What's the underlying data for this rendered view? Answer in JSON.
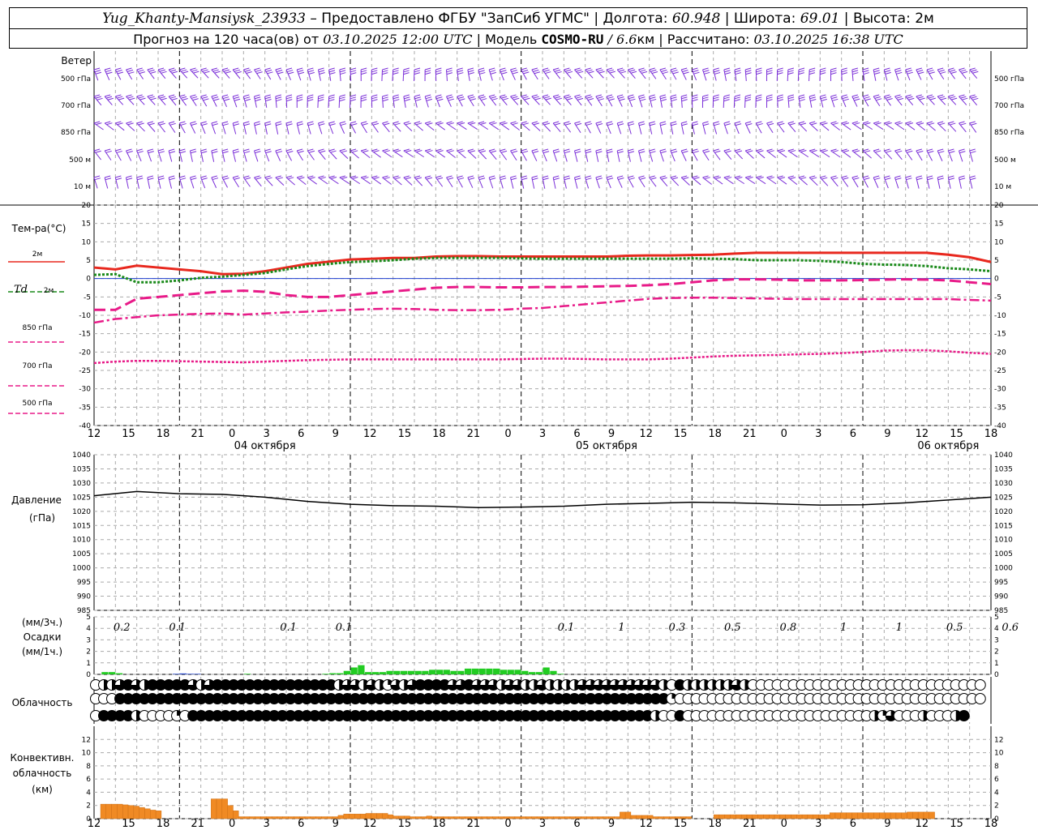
{
  "header": {
    "station": "Yug_Khanty-Mansiysk_23933",
    "provider": " – Предоставлено ФГБУ \"ЗапСиб УГМС\" | Долгота: ",
    "longitude": "60.948",
    "lat_label": " | Широта: ",
    "latitude": "69.01",
    "alt_label": " | Высота: 2м",
    "forecast_prefix": "Прогноз на 120 часа(ов) от ",
    "run_time": "03.10.2025 12:00 UTC",
    "model_prefix": " | Модель ",
    "model": "COSMO-RU",
    "resolution": " / 6.6",
    "res_unit": "км | Рассчитано: ",
    "computed": "03.10.2025 16:38 UTC"
  },
  "colors": {
    "wind": "#7b2fd8",
    "t2m": "#e8281e",
    "td2m": "#1a8a1a",
    "t850": "#e81a88",
    "t700": "#e81a88",
    "t500": "#e81a88",
    "zero": "#1f3fd0",
    "pressure": "#000000",
    "precip": "#22cc22",
    "precip_small": "#2244cc",
    "convective": "#f08a24",
    "grid": "#aaaaaa"
  },
  "x_axis": {
    "hours": [
      "12",
      "15",
      "18",
      "21",
      "0",
      "3",
      "6",
      "9",
      "12",
      "15",
      "18",
      "21",
      "0",
      "3",
      "6",
      "9",
      "12",
      "15",
      "18",
      "21",
      "0",
      "3",
      "6",
      "9",
      "12",
      "15",
      "18"
    ],
    "day_labels": [
      "04 октября",
      "05 октября",
      "06 октября"
    ]
  },
  "wind_panel": {
    "title": "Ветер",
    "levels": [
      "500 гПа",
      "700 гПа",
      "850 гПа",
      "500 м",
      "10  м"
    ]
  },
  "chart_data": [
    {
      "type": "line",
      "title": "Тем-ра(°C)",
      "ylim": [
        -40,
        20
      ],
      "yticks": [
        "20",
        "15",
        "10",
        "5",
        "0",
        "-5",
        "-10",
        "-15",
        "-20",
        "-25",
        "-30",
        "-35",
        "-40"
      ],
      "x_hours_from_start": [
        0,
        3,
        6,
        9,
        12,
        15,
        18,
        21,
        24,
        27,
        30,
        33,
        36,
        39,
        42,
        45,
        48,
        51,
        54,
        57,
        60,
        63,
        66,
        69,
        72,
        75,
        78,
        81,
        84,
        87,
        90,
        93,
        96,
        99,
        102,
        105,
        108,
        111,
        114,
        117,
        120,
        123,
        126
      ],
      "series": [
        {
          "name": "2м",
          "values": [
            3,
            2.5,
            3.5,
            3,
            2.5,
            2,
            1.2,
            1.3,
            2,
            3,
            4,
            4.6,
            5.2,
            5.4,
            5.6,
            5.6,
            6,
            6.1,
            6.1,
            6,
            6,
            6,
            6,
            6,
            6,
            6.2,
            6.3,
            6.3,
            6.4,
            6.5,
            6.8,
            7,
            7,
            7,
            7,
            7,
            7,
            7,
            7,
            7,
            6.5,
            5.8,
            4.5
          ]
        },
        {
          "name": "Td 2м",
          "values": [
            1,
            1.2,
            -1,
            -1,
            -0.5,
            0.2,
            0.5,
            1,
            1.5,
            2.5,
            3.4,
            4,
            4.5,
            4.7,
            5,
            5.4,
            5.6,
            5.6,
            5.6,
            5.6,
            5.5,
            5.4,
            5.4,
            5.4,
            5.4,
            5.4,
            5.4,
            5.4,
            5.5,
            5.4,
            5.3,
            5,
            5,
            5,
            4.8,
            4.5,
            4,
            3.8,
            3.7,
            3.4,
            2.8,
            2.5,
            2
          ]
        },
        {
          "name": "850 гПа",
          "values": [
            -8.5,
            -8.5,
            -5.5,
            -5,
            -4.5,
            -4,
            -3.5,
            -3.3,
            -3.6,
            -4.5,
            -5,
            -5,
            -4.5,
            -4,
            -3.5,
            -3,
            -2.5,
            -2.3,
            -2.3,
            -2.4,
            -2.4,
            -2.3,
            -2.3,
            -2.2,
            -2.1,
            -2,
            -1.8,
            -1.5,
            -1,
            -0.5,
            -0.2,
            -0.2,
            -0.3,
            -0.5,
            -0.5,
            -0.5,
            -0.4,
            -0.3,
            -0.2,
            -0.3,
            -0.5,
            -1,
            -1.5
          ]
        },
        {
          "name": "700 гПа",
          "values": [
            -12,
            -11,
            -10.5,
            -10,
            -9.8,
            -9.6,
            -9.5,
            -9.8,
            -9.5,
            -9.2,
            -9,
            -8.7,
            -8.5,
            -8.3,
            -8.2,
            -8.3,
            -8.5,
            -8.6,
            -8.6,
            -8.5,
            -8.2,
            -8,
            -7.5,
            -7,
            -6.5,
            -6,
            -5.5,
            -5.3,
            -5.2,
            -5.2,
            -5.3,
            -5.4,
            -5.5,
            -5.6,
            -5.6,
            -5.6,
            -5.6,
            -5.6,
            -5.6,
            -5.6,
            -5.6,
            -5.8,
            -6
          ]
        },
        {
          "name": "500 гПа",
          "values": [
            -23,
            -22.6,
            -22.4,
            -22.4,
            -22.5,
            -22.6,
            -22.7,
            -22.8,
            -22.6,
            -22.4,
            -22.2,
            -22.1,
            -22,
            -22,
            -22,
            -22,
            -22,
            -22,
            -22,
            -22,
            -21.9,
            -21.8,
            -21.8,
            -21.9,
            -22,
            -22,
            -22,
            -21.8,
            -21.5,
            -21.2,
            -21,
            -20.9,
            -20.8,
            -20.6,
            -20.5,
            -20.3,
            -20,
            -19.6,
            -19.5,
            -19.5,
            -19.8,
            -20.2,
            -20.5
          ]
        }
      ]
    },
    {
      "type": "line",
      "title": "Давление",
      "ylabel": "(гПа)",
      "ylim": [
        985,
        1040
      ],
      "yticks": [
        "1040",
        "1035",
        "1030",
        "1025",
        "1020",
        "1015",
        "1010",
        "1005",
        "1000",
        "995",
        "990",
        "985"
      ],
      "x_hours_from_start": [
        0,
        6,
        12,
        18,
        24,
        30,
        36,
        42,
        48,
        54,
        60,
        66,
        72,
        78,
        84,
        90,
        96,
        102,
        108,
        114,
        120,
        126
      ],
      "values": [
        1025.5,
        1027,
        1026.2,
        1026,
        1025,
        1023.5,
        1022.5,
        1022,
        1021.8,
        1021.3,
        1021.5,
        1021.8,
        1022.5,
        1022.8,
        1023.2,
        1023,
        1022.6,
        1022.2,
        1022.3,
        1023,
        1024,
        1025
      ]
    },
    {
      "type": "bar",
      "title": "Осадки",
      "ylabel_top": "(мм/3ч.)",
      "ylabel_bottom": "(мм/1ч.)",
      "ylim": [
        0,
        5
      ],
      "yticks": [
        "5",
        "4",
        "3",
        "2",
        "1",
        "0"
      ],
      "labels_3h": [
        {
          "hour": "1.5",
          "text": "0.2"
        },
        {
          "hour": "4.5",
          "text": "0.1"
        },
        {
          "hour": "10.5",
          "text": "0.1"
        },
        {
          "hour": "13.5",
          "text": "0.1"
        },
        {
          "hour": "25.5",
          "text": "0.1"
        },
        {
          "hour": "28.5",
          "text": "1"
        },
        {
          "hour": "31.5",
          "text": "0.3"
        },
        {
          "hour": "34.5",
          "text": "0.5"
        },
        {
          "hour": "37.5",
          "text": "0.8"
        },
        {
          "hour": "40.5",
          "text": "1"
        },
        {
          "hour": "43.5",
          "text": "1"
        },
        {
          "hour": "46.5",
          "text": "0.5"
        },
        {
          "hour": "49.5",
          "text": "0.6"
        }
      ],
      "hourly": [
        0,
        0.2,
        0.2,
        0.1,
        0,
        0,
        0,
        0,
        0,
        0,
        0,
        0.05,
        0.08,
        0.05,
        0.05,
        0,
        0,
        0,
        0,
        0,
        0,
        0.05,
        0,
        0,
        0,
        0,
        0,
        0,
        0,
        0,
        0,
        0,
        0.05,
        0.1,
        0.1,
        0.3,
        0.6,
        0.8,
        0.2,
        0.2,
        0.2,
        0.3,
        0.3,
        0.3,
        0.3,
        0.3,
        0.3,
        0.4,
        0.4,
        0.4,
        0.3,
        0.3,
        0.5,
        0.5,
        0.5,
        0.5,
        0.5,
        0.4,
        0.4,
        0.4,
        0.3,
        0.2,
        0.2,
        0.6,
        0.3,
        0.05
      ]
    },
    {
      "type": "bar",
      "title": "Конвективн.",
      "subtitle": "облачность",
      "ylabel": "(км)",
      "ylim": [
        0,
        14
      ],
      "yticks": [
        "12",
        "10",
        "8",
        "6",
        "4",
        "2",
        "0"
      ],
      "hourly": [
        2.2,
        2.2,
        2.2,
        2.2,
        2.1,
        2,
        1.9,
        1.7,
        1.5,
        1.3,
        1.2,
        0,
        0,
        0,
        0,
        0,
        0,
        0,
        0,
        0,
        3,
        3,
        3,
        2,
        1.2,
        0.3,
        0.3,
        0.3,
        0.3,
        0.3,
        0.3,
        0.3,
        0.3,
        0.3,
        0.3,
        0.3,
        0.3,
        0.3,
        0.3,
        0.3,
        0.3,
        0.3,
        0.3,
        0.5,
        0.7,
        0.7,
        0.7,
        0.7,
        0.8,
        0.8,
        0.8,
        0.8,
        0.6,
        0.4,
        0.4,
        0.4,
        0.3,
        0.3,
        0.3,
        0.4,
        0.3,
        0.3,
        0.3,
        0.3,
        0.3,
        0.3,
        0.3,
        0.3,
        0.3,
        0.3,
        0.3,
        0.3,
        0.3,
        0.3,
        0.3,
        0.3,
        0.3,
        0.3,
        0.3,
        0.3,
        0.3,
        0.3,
        0.3,
        0.3,
        0.3,
        0.3,
        0.3,
        0.3,
        0.3,
        0.3,
        0.3,
        0.3,
        0.3,
        0.3,
        1,
        1,
        0.5,
        0.5,
        0.5,
        0.5,
        0.3,
        0.3,
        0.3,
        0.3,
        0.3,
        0.3,
        0.3,
        0,
        0,
        0,
        0,
        0.6,
        0.6,
        0.6,
        0.6,
        0.6,
        0.6,
        0.6,
        0.6,
        0.6,
        0.6,
        0.6,
        0.6,
        0.6,
        0.6,
        0.6,
        0.6,
        0.6,
        0.6,
        0.6,
        0.6,
        0.6,
        0.9,
        0.9,
        0.9,
        0.9,
        0.9,
        0.9,
        0.9,
        0.9,
        0.9,
        0.9,
        0.9,
        0.9,
        0.9,
        0.9,
        1,
        1,
        1,
        1,
        1
      ]
    }
  ],
  "cloud_panel": {
    "title": "Облачность",
    "rows_eighths": [
      [
        0,
        4,
        4,
        6,
        8,
        6,
        4,
        8,
        8,
        8,
        8,
        8,
        6,
        4,
        6,
        8,
        8,
        8,
        8,
        8,
        8,
        8,
        8,
        8,
        8,
        8,
        8,
        8,
        8,
        8,
        4,
        6,
        6,
        4,
        6,
        4,
        2,
        6,
        4,
        6,
        8,
        8,
        8,
        8,
        6,
        6,
        8,
        6,
        6,
        6,
        4,
        6,
        6,
        4,
        4,
        6,
        4,
        4,
        4,
        4,
        6,
        6,
        6,
        6,
        6,
        6,
        6,
        6,
        6,
        6,
        4,
        0,
        8,
        4,
        4,
        4,
        4,
        4,
        4,
        6,
        4,
        0,
        0,
        0,
        0,
        0,
        0,
        0,
        0,
        0,
        0,
        0,
        0,
        0,
        0,
        0,
        0,
        0,
        0,
        0,
        0,
        0,
        0,
        0,
        0,
        0,
        0,
        0,
        0,
        0,
        0,
        0,
        0,
        0
      ],
      [
        0,
        0,
        0,
        8,
        8,
        8,
        8,
        8,
        8,
        8,
        8,
        8,
        8,
        8,
        8,
        8,
        8,
        8,
        8,
        8,
        8,
        8,
        8,
        8,
        8,
        8,
        8,
        8,
        8,
        8,
        8,
        8,
        8,
        8,
        8,
        8,
        8,
        8,
        8,
        8,
        8,
        8,
        8,
        8,
        8,
        8,
        8,
        8,
        8,
        8,
        8,
        8,
        8,
        8,
        8,
        8,
        8,
        8,
        8,
        8,
        8,
        8,
        8,
        8,
        8,
        8,
        8,
        8,
        8,
        8,
        8,
        2,
        0,
        0,
        0,
        0,
        0,
        0,
        0,
        0,
        0,
        0,
        0,
        0,
        0,
        0,
        0,
        0,
        0,
        0,
        0,
        0,
        0,
        0,
        0,
        0,
        0,
        0,
        0,
        0,
        0,
        0,
        0,
        0,
        0,
        0,
        0,
        0,
        0,
        0,
        0,
        0,
        0
      ],
      [
        0,
        8,
        8,
        8,
        8,
        4,
        0,
        0,
        0,
        0,
        2,
        0,
        8,
        8,
        8,
        8,
        8,
        8,
        8,
        8,
        8,
        8,
        8,
        8,
        8,
        8,
        8,
        8,
        8,
        8,
        8,
        8,
        8,
        8,
        8,
        8,
        8,
        8,
        8,
        8,
        8,
        8,
        8,
        8,
        8,
        8,
        8,
        8,
        8,
        8,
        8,
        8,
        8,
        8,
        8,
        8,
        8,
        8,
        8,
        8,
        8,
        8,
        8,
        8,
        8,
        8,
        8,
        8,
        8,
        4,
        0,
        0,
        8,
        0,
        0,
        0,
        0,
        0,
        0,
        0,
        0,
        0,
        0,
        0,
        0,
        0,
        0,
        0,
        0,
        0,
        0,
        0,
        0,
        0,
        0,
        0,
        4,
        2,
        6,
        0,
        0,
        0,
        4,
        0,
        0,
        0,
        4,
        8
      ]
    ]
  },
  "legend": {
    "t2m": "2м",
    "td_sym": "Td",
    "td_lvl": "2м",
    "t850": "850 гПа",
    "t700": "700 гПа",
    "t500": "500 гПа"
  }
}
